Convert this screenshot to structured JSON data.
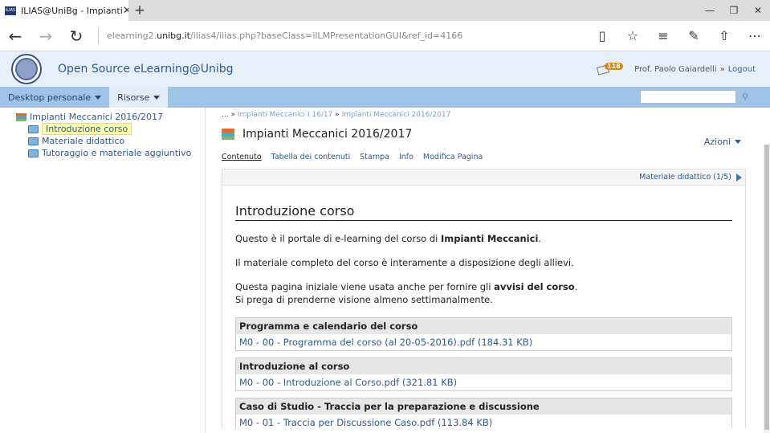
{
  "browser": {
    "tab_title": "ILIAS@UniBg - Impianti",
    "tab_favicon_text": "ILIAS",
    "url_prefix": "elearning2.",
    "url_domain": "unibg.it",
    "url_path": "/ilias4/ilias.php?baseClass=ilLMPresentationGUI&ref_id=4166"
  },
  "header": {
    "site_title": "Open Source eLearning@Unibg",
    "notification_count": "118",
    "user_name": "Prof. Paolo Gaiardelli",
    "separator": "»",
    "logout_label": "Logout"
  },
  "menu": {
    "items": [
      {
        "label": "Desktop personale"
      },
      {
        "label": "Risorse"
      }
    ],
    "search_placeholder": ""
  },
  "tree": {
    "root": "Impianti Meccanici 2016/2017",
    "children": [
      {
        "label": "Introduzione corso"
      },
      {
        "label": "Materiale didattico"
      },
      {
        "label": "Tutoraggio e materiale aggiuntivo"
      }
    ]
  },
  "breadcrumb": {
    "ellipsis": "...",
    "sep": "»",
    "items": [
      "Impianti Meccanici I 16/17",
      "Impianti Meccanici 2016/2017"
    ]
  },
  "page_title": "Impianti Meccanici 2016/2017",
  "actions_label": "Azioni",
  "subtabs": [
    "Contenuto",
    "Tabella dei contenuti",
    "Stampa",
    "Info",
    "Modifica Pagina"
  ],
  "page_nav": "Materiale didattico (1/5)",
  "page": {
    "heading": "Introduzione corso",
    "p1_a": "Questo è il portale di e-learning del corso di ",
    "p1_b": "Impianti Meccanici",
    "p1_c": ".",
    "p2": "Il materiale completo del corso è interamente a disposizione degli allievi.",
    "p3_a": "Questa pagina iniziale viene usata anche per fornire gli ",
    "p3_b": "avvisi del corso",
    "p3_c": ".",
    "p3_d": "Si prega di prenderne visione almeno settimanalmente.",
    "files": [
      {
        "header": "Programma e calendario del corso",
        "link": "M0 - 00 - Programma del corso (al 20-05-2016).pdf (184.31 KB)"
      },
      {
        "header": "Introduzione al corso",
        "link": "M0 - 00 - Introduzione al Corso.pdf (321.81 KB)"
      },
      {
        "header": "Caso di Studio - Traccia per la preparazione e discussione",
        "link": "M0 - 01 - Traccia per Discussione Caso.pdf (113.84 KB)"
      }
    ]
  },
  "colors": {
    "header_bg": "#e6f0fb",
    "menubar_bg": "#9fc4e8",
    "link": "#2c5a92"
  }
}
